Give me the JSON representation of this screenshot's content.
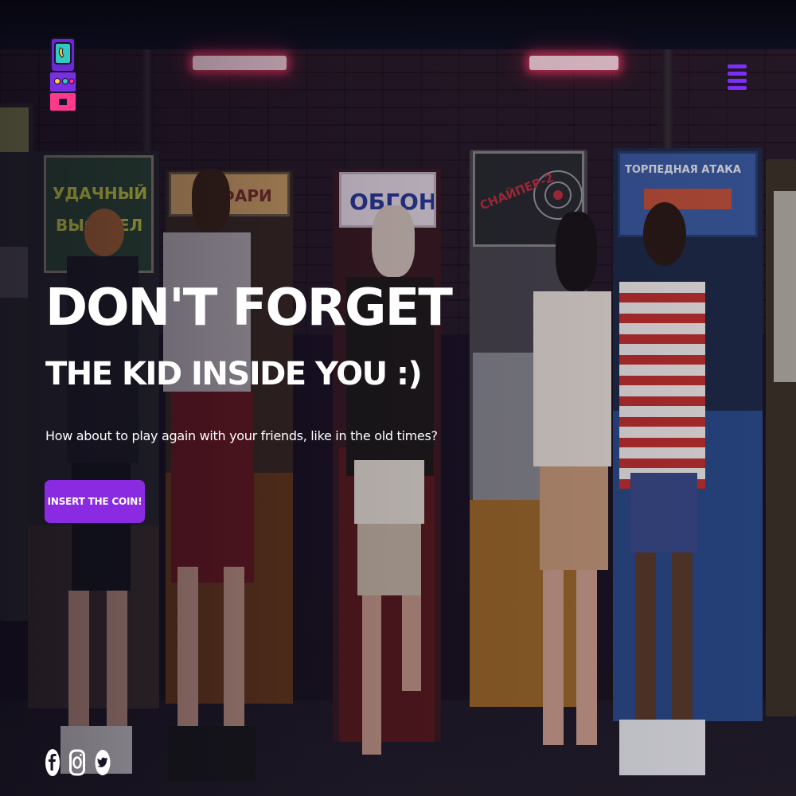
{
  "brand": {
    "logo_icon": "arcade-machine-icon",
    "accent_color": "#8a2be2",
    "menu_color": "#7b2ff7"
  },
  "header": {
    "menu_icon": "hamburger-menu-icon"
  },
  "hero": {
    "headline": "DON'T FORGET",
    "subheadline": "THE KID INSIDE YOU :)",
    "tagline": "How about to play again with your friends, like in the old times?",
    "cta_label": "INSERT THE COIN!"
  },
  "social": [
    {
      "name": "facebook",
      "icon": "facebook-icon"
    },
    {
      "name": "instagram",
      "icon": "instagram-icon"
    },
    {
      "name": "twitter",
      "icon": "twitter-icon"
    }
  ],
  "background": {
    "description_icon": "arcade-room-photo",
    "cabinet_signs": [
      "УДАЧНЫЙ ВЫСТРЕЛ",
      "САФАРИ",
      "ОБГОН",
      "СНАЙПЕР-2",
      "ТОРПЕДНАЯ АТАКА"
    ]
  }
}
